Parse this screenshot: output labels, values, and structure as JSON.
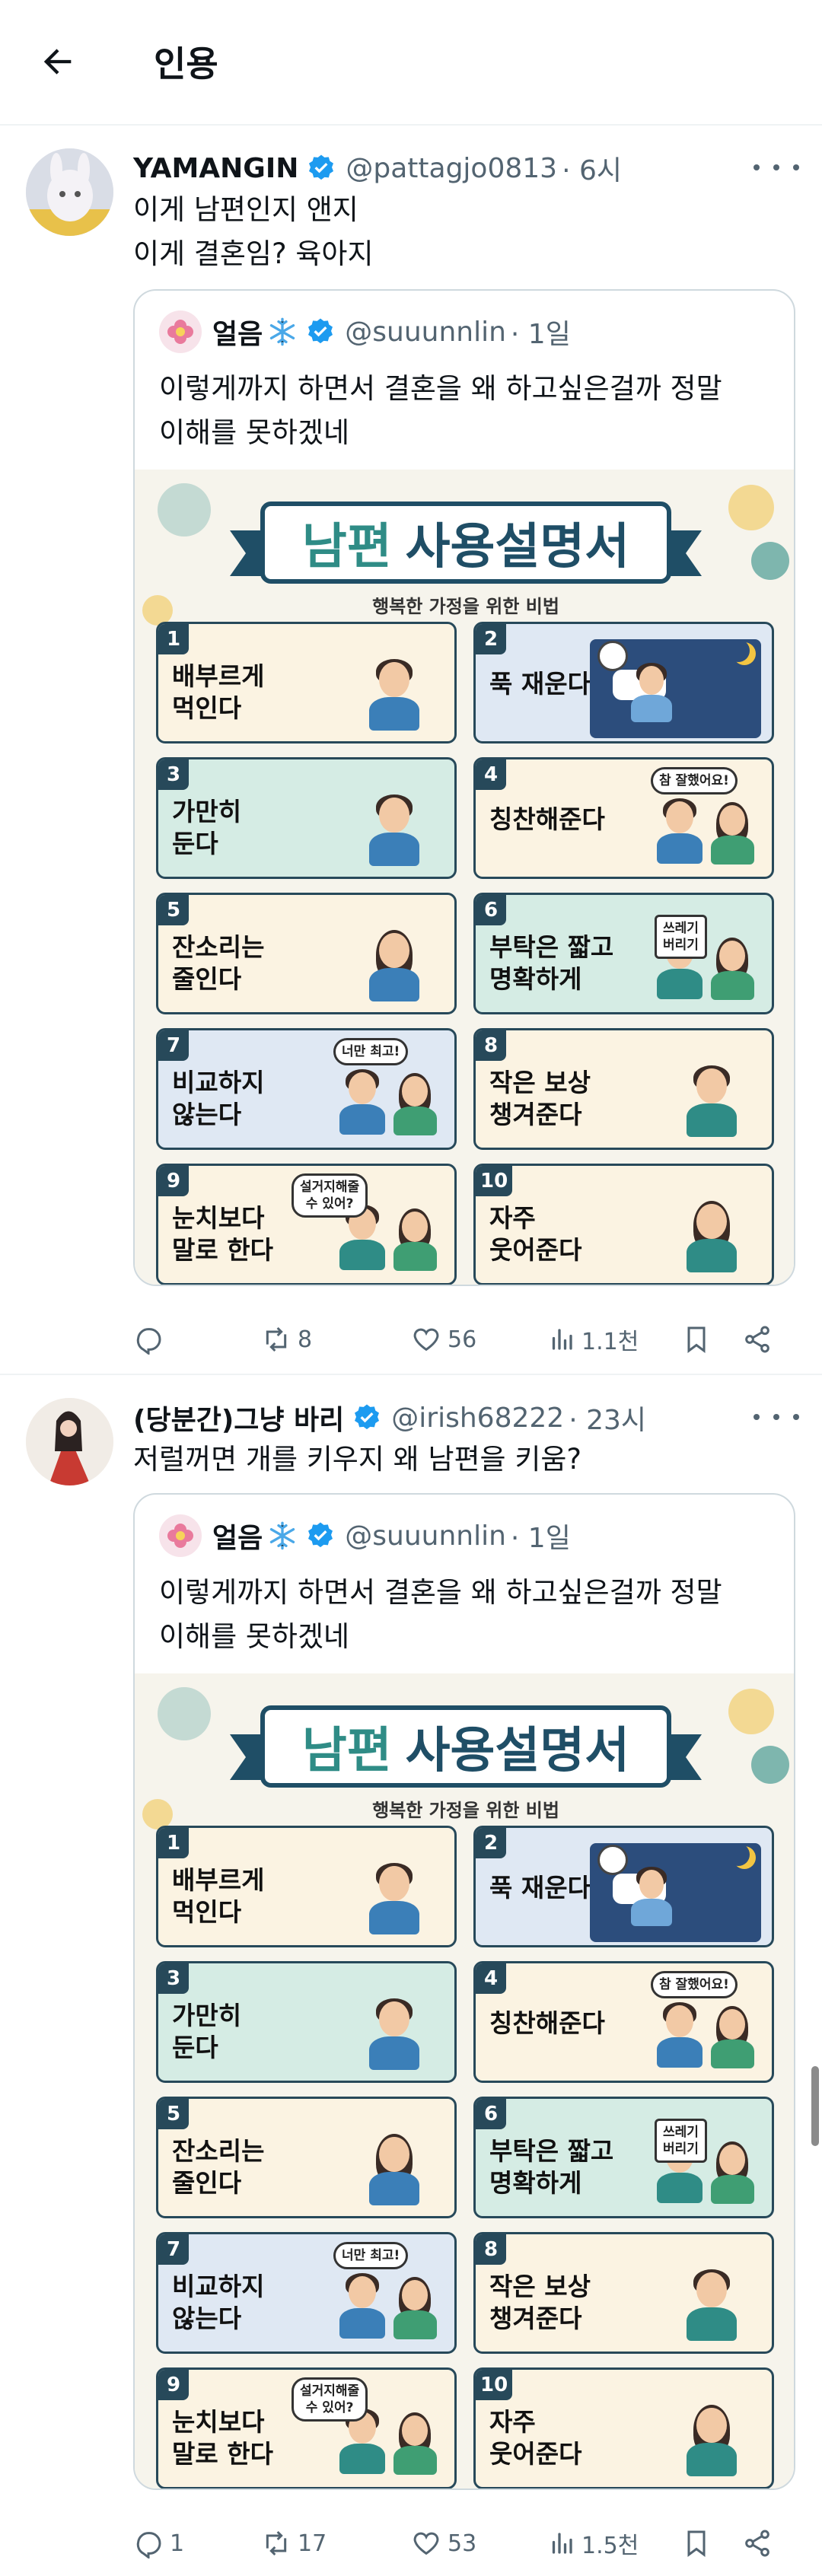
{
  "header": {
    "title": "인용"
  },
  "colors": {
    "accent": "#1d9bf0",
    "muted": "#536471",
    "border": "#cfd9de",
    "navy": "#1f4e66"
  },
  "infographic": {
    "title_accent": "남편",
    "title_rest": "사용설명서",
    "subtitle": "행복한 가정을 위한 비법",
    "cards": [
      {
        "num": "1",
        "label": "배부르게\n먹인다",
        "bg": "#fbf3e2"
      },
      {
        "num": "2",
        "label": "푹 재운다",
        "bg": "#dfe8f3"
      },
      {
        "num": "3",
        "label": "가만히\n둔다",
        "bg": "#d5ece4"
      },
      {
        "num": "4",
        "label": "칭찬해준다",
        "bg": "#fbf3e2",
        "bubble": "참 잘했어요!"
      },
      {
        "num": "5",
        "label": "잔소리는\n줄인다",
        "bg": "#fbf3e2"
      },
      {
        "num": "6",
        "label": "부탁은 짧고\n명확하게",
        "bg": "#d5ece4",
        "note": "쓰레기\n버리기"
      },
      {
        "num": "7",
        "label": "비교하지\n않는다",
        "bg": "#dfe8f3",
        "bubble": "너만 최고!"
      },
      {
        "num": "8",
        "label": "작은 보상\n챙겨준다",
        "bg": "#fbf3e2"
      },
      {
        "num": "9",
        "label": "눈치보다\n말로 한다",
        "bg": "#fbf3e2",
        "bubble": "설거지해줄\n수 있어?"
      },
      {
        "num": "10",
        "label": "자주\n웃어준다",
        "bg": "#fbf3e2"
      }
    ]
  },
  "posts": [
    {
      "name": "YAMANGIN",
      "handle": "@pattagjo0813",
      "time": "· 6시",
      "text1": "이게 남편인지 앤지",
      "text2": "이게 결혼임? 육아지",
      "quote": {
        "name": "얼음",
        "handle": "@suuunnlin",
        "time": "· 1일",
        "text1": "이렇게까지 하면서 결혼을 왜 하고싶은걸까 정말",
        "text2": "이해를 못하겠네"
      },
      "stats": {
        "replies": "",
        "reposts": "8",
        "likes": "56",
        "views": "1.1천"
      }
    },
    {
      "name": "(당분간)그냥 바리",
      "handle": "@irish68222",
      "time": "· 23시",
      "text1": "저럴꺼면 개를 키우지 왜 남편을 키움?",
      "quote": {
        "name": "얼음",
        "handle": "@suuunnlin",
        "time": "· 1일",
        "text1": "이렇게까지 하면서 결혼을 왜 하고싶은걸까 정말",
        "text2": "이해를 못하겠네"
      },
      "stats": {
        "replies": "1",
        "reposts": "17",
        "likes": "53",
        "views": "1.5천"
      }
    }
  ]
}
